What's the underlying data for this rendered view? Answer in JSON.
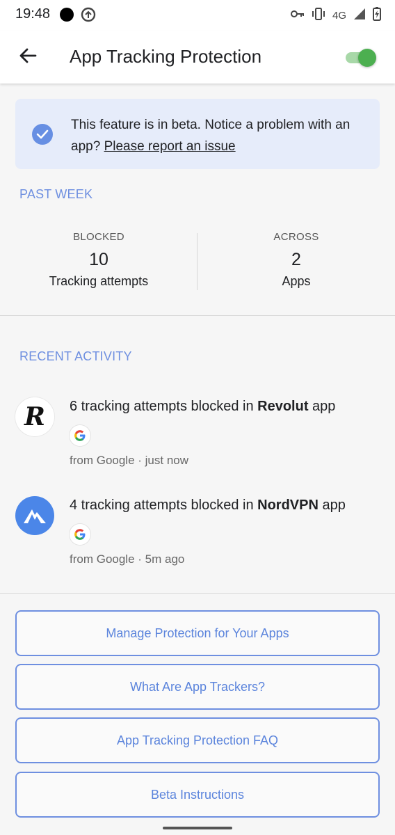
{
  "status_bar": {
    "time": "19:48",
    "network": "4G",
    "icons": [
      "dot-icon",
      "sync-icon",
      "vpn-key-icon",
      "vibrate-icon",
      "signal-icon",
      "battery-charging-icon"
    ]
  },
  "app_bar": {
    "title": "App Tracking Protection",
    "back_icon": "arrow-back-icon",
    "toggle_on": true
  },
  "beta_notice": {
    "text": "This feature is in beta. Notice a problem with an app?",
    "link": "Please report an issue"
  },
  "past_week": {
    "title": "PAST WEEK",
    "blocked": {
      "label": "BLOCKED",
      "value": "10",
      "sub": "Tracking attempts"
    },
    "across": {
      "label": "ACROSS",
      "value": "2",
      "sub": "Apps"
    }
  },
  "recent_activity": {
    "title": "RECENT ACTIVITY",
    "items": [
      {
        "prefix": "6 tracking attempts blocked in ",
        "app": "Revolut",
        "suffix": " app",
        "meta": "from Google · just now",
        "avatar_letter": "R"
      },
      {
        "prefix": "4 tracking attempts blocked in ",
        "app": "NordVPN",
        "suffix": " app",
        "meta": "from Google · 5m ago",
        "avatar_letter": ""
      }
    ]
  },
  "buttons": [
    "Manage Protection for Your Apps",
    "What Are App Trackers?",
    "App Tracking Protection FAQ",
    "Beta Instructions"
  ],
  "colors": {
    "accent": "#6e8fe0",
    "toggle_on": "#4caf50",
    "beta_bg": "#e6ecfa",
    "nord_blue": "#4b86e8"
  }
}
